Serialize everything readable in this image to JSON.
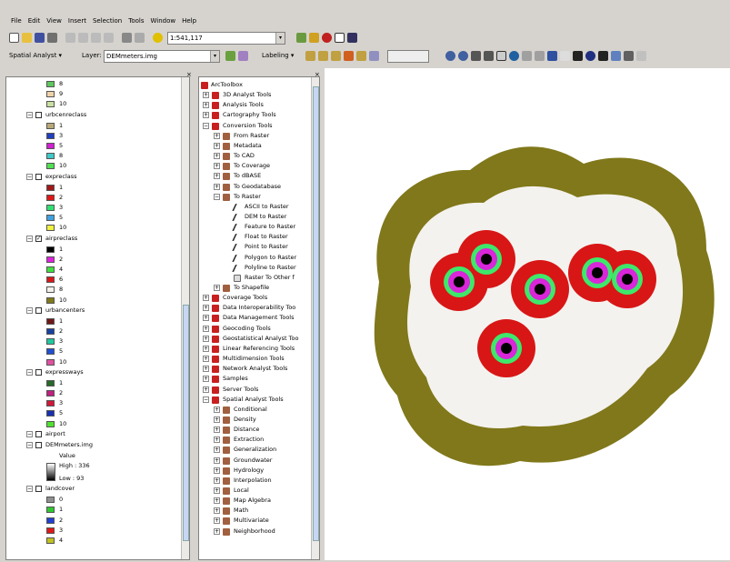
{
  "menu": [
    "File",
    "Edit",
    "View",
    "Insert",
    "Selection",
    "Tools",
    "Window",
    "Help"
  ],
  "toolbar": {
    "scale": "1:541,117",
    "spatial_analyst": "Spatial Analyst ▾",
    "layer_label": "Layer:",
    "layer_value": "DEMmeters.img",
    "labeling": "Labeling ▾"
  },
  "toc": [
    {
      "kind": "legend",
      "color": "#5dc85d",
      "label": "8"
    },
    {
      "kind": "legend",
      "color": "#f0d2a8",
      "label": "9"
    },
    {
      "kind": "legend",
      "color": "#c8e0a0",
      "label": "10"
    },
    {
      "kind": "layer",
      "label": "urbcenreclass",
      "checked": false
    },
    {
      "kind": "legend",
      "color": "#b8a878",
      "label": "1"
    },
    {
      "kind": "legend",
      "color": "#2040c0",
      "label": "3"
    },
    {
      "kind": "legend",
      "color": "#d020d0",
      "label": "5"
    },
    {
      "kind": "legend",
      "color": "#40c8c8",
      "label": "8"
    },
    {
      "kind": "legend",
      "color": "#50e050",
      "label": "10"
    },
    {
      "kind": "layer",
      "label": "expreclass",
      "checked": false
    },
    {
      "kind": "legend",
      "color": "#a01818",
      "label": "1"
    },
    {
      "kind": "legend",
      "color": "#e01818",
      "label": "2"
    },
    {
      "kind": "legend",
      "color": "#30e070",
      "label": "3"
    },
    {
      "kind": "legend",
      "color": "#40a0e0",
      "label": "5"
    },
    {
      "kind": "legend",
      "color": "#f0f040",
      "label": "10"
    },
    {
      "kind": "layer",
      "label": "airpreclass",
      "checked": true
    },
    {
      "kind": "legend",
      "color": "#000000",
      "label": "1"
    },
    {
      "kind": "legend",
      "color": "#e020e0",
      "label": "2"
    },
    {
      "kind": "legend",
      "color": "#40e040",
      "label": "4"
    },
    {
      "kind": "legend",
      "color": "#d81818",
      "label": "6"
    },
    {
      "kind": "legend",
      "color": "#f4f0ea",
      "label": "8"
    },
    {
      "kind": "legend",
      "color": "#807a18",
      "label": "10"
    },
    {
      "kind": "layer",
      "label": "urbancenters",
      "checked": false
    },
    {
      "kind": "legend",
      "color": "#701818",
      "label": "1"
    },
    {
      "kind": "legend",
      "color": "#1a40a0",
      "label": "2"
    },
    {
      "kind": "legend",
      "color": "#20c8a0",
      "label": "3"
    },
    {
      "kind": "legend",
      "color": "#2050d0",
      "label": "5"
    },
    {
      "kind": "legend",
      "color": "#e050a0",
      "label": "10"
    },
    {
      "kind": "layer",
      "label": "expressways",
      "checked": false
    },
    {
      "kind": "legend",
      "color": "#286828",
      "label": "1"
    },
    {
      "kind": "legend",
      "color": "#c02080",
      "label": "2"
    },
    {
      "kind": "legend",
      "color": "#d01838",
      "label": "3"
    },
    {
      "kind": "legend",
      "color": "#1830b0",
      "label": "5"
    },
    {
      "kind": "legend",
      "color": "#50e030",
      "label": "10"
    },
    {
      "kind": "layer",
      "label": "airport",
      "checked": false
    },
    {
      "kind": "layer",
      "label": "DEMmeters.img",
      "checked": false
    },
    {
      "kind": "text",
      "label": "Value"
    },
    {
      "kind": "ramp",
      "label": "High : 336"
    },
    {
      "kind": "ramp2",
      "label": "Low : 93"
    },
    {
      "kind": "layer",
      "label": "landcover",
      "checked": false
    },
    {
      "kind": "legend",
      "color": "#909090",
      "label": "0"
    },
    {
      "kind": "legend",
      "color": "#30c830",
      "label": "1"
    },
    {
      "kind": "legend",
      "color": "#2040d0",
      "label": "2"
    },
    {
      "kind": "legend",
      "color": "#e01818",
      "label": "3"
    },
    {
      "kind": "legend",
      "color": "#c0c020",
      "label": "4"
    }
  ],
  "toolbox": [
    {
      "level": 0,
      "label": "ArcToolbox",
      "type": "root"
    },
    {
      "level": 1,
      "label": "3D Analyst Tools",
      "type": "box"
    },
    {
      "level": 1,
      "label": "Analysis Tools",
      "type": "box"
    },
    {
      "level": 1,
      "label": "Cartography Tools",
      "type": "box"
    },
    {
      "level": 1,
      "label": "Conversion Tools",
      "type": "box",
      "open": true
    },
    {
      "level": 2,
      "label": "From Raster",
      "type": "set"
    },
    {
      "level": 2,
      "label": "Metadata",
      "type": "set"
    },
    {
      "level": 2,
      "label": "To CAD",
      "type": "set"
    },
    {
      "level": 2,
      "label": "To Coverage",
      "type": "set"
    },
    {
      "level": 2,
      "label": "To dBASE",
      "type": "set"
    },
    {
      "level": 2,
      "label": "To Geodatabase",
      "type": "set"
    },
    {
      "level": 2,
      "label": "To Raster",
      "type": "set",
      "open": true
    },
    {
      "level": 3,
      "label": "ASCII to Raster",
      "type": "tool"
    },
    {
      "level": 3,
      "label": "DEM to Raster",
      "type": "tool"
    },
    {
      "level": 3,
      "label": "Feature to Raster",
      "type": "tool"
    },
    {
      "level": 3,
      "label": "Float to Raster",
      "type": "tool"
    },
    {
      "level": 3,
      "label": "Point to Raster",
      "type": "tool"
    },
    {
      "level": 3,
      "label": "Polygon to Raster",
      "type": "tool"
    },
    {
      "level": 3,
      "label": "Polyline to Raster",
      "type": "tool"
    },
    {
      "level": 3,
      "label": "Raster To Other f",
      "type": "script"
    },
    {
      "level": 2,
      "label": "To Shapefile",
      "type": "set"
    },
    {
      "level": 1,
      "label": "Coverage Tools",
      "type": "box"
    },
    {
      "level": 1,
      "label": "Data Interoperability Too",
      "type": "box"
    },
    {
      "level": 1,
      "label": "Data Management Tools",
      "type": "box"
    },
    {
      "level": 1,
      "label": "Geocoding Tools",
      "type": "box"
    },
    {
      "level": 1,
      "label": "Geostatistical Analyst Too",
      "type": "box"
    },
    {
      "level": 1,
      "label": "Linear Referencing Tools",
      "type": "box"
    },
    {
      "level": 1,
      "label": "Multidimension Tools",
      "type": "box"
    },
    {
      "level": 1,
      "label": "Network Analyst Tools",
      "type": "box"
    },
    {
      "level": 1,
      "label": "Samples",
      "type": "box"
    },
    {
      "level": 1,
      "label": "Server Tools",
      "type": "box"
    },
    {
      "level": 1,
      "label": "Spatial Analyst Tools",
      "type": "box",
      "open": true
    },
    {
      "level": 2,
      "label": "Conditional",
      "type": "set"
    },
    {
      "level": 2,
      "label": "Density",
      "type": "set"
    },
    {
      "level": 2,
      "label": "Distance",
      "type": "set"
    },
    {
      "level": 2,
      "label": "Extraction",
      "type": "set"
    },
    {
      "level": 2,
      "label": "Generalization",
      "type": "set"
    },
    {
      "level": 2,
      "label": "Groundwater",
      "type": "set"
    },
    {
      "level": 2,
      "label": "Hydrology",
      "type": "set"
    },
    {
      "level": 2,
      "label": "Interpolation",
      "type": "set"
    },
    {
      "level": 2,
      "label": "Local",
      "type": "set"
    },
    {
      "level": 2,
      "label": "Map Algebra",
      "type": "set"
    },
    {
      "level": 2,
      "label": "Math",
      "type": "set"
    },
    {
      "level": 2,
      "label": "Multivariate",
      "type": "set"
    },
    {
      "level": 2,
      "label": "Neighborhood",
      "type": "set"
    }
  ],
  "colors": {
    "olive": "#80781a",
    "offwhite": "#f4f2ee",
    "red": "#d81616",
    "green": "#3ee86a",
    "magenta": "#d826d8",
    "black": "#000000"
  }
}
